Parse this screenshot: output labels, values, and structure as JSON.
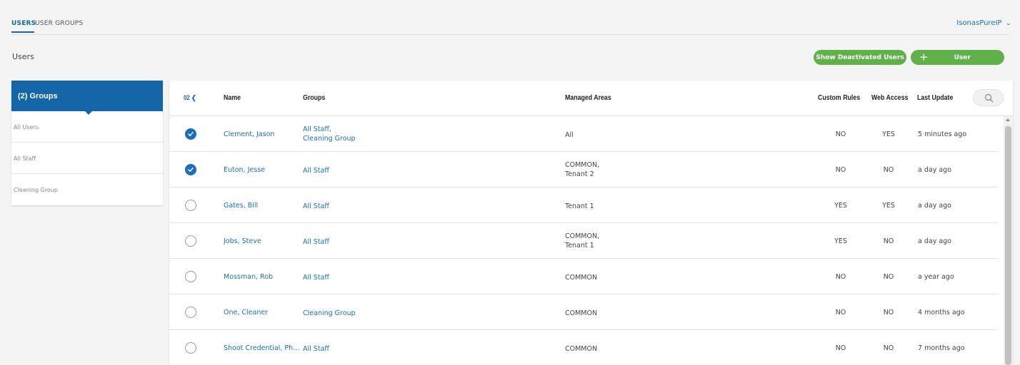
{
  "tabs": [
    {
      "label": "USERS",
      "active": true
    },
    {
      "label": "USER GROUPS",
      "active": false
    }
  ],
  "account": {
    "name": "IsonasPureIP",
    "icon": "chevron-down-icon"
  },
  "page_title": "Users",
  "actions": {
    "show_deactivated": "Show Deactivated Users",
    "add_user_icon": "+",
    "add_user": "User"
  },
  "groups_panel": {
    "header": "(2) Groups",
    "items": [
      "All Users",
      "All Staff",
      "Cleaning Group"
    ]
  },
  "table": {
    "selected_count": "02",
    "columns": {
      "name": "Name",
      "groups": "Groups",
      "areas": "Managed Areas",
      "custom_rules": "Custom Rules",
      "web_access": "Web Access",
      "last_update": "Last Update"
    },
    "rows": [
      {
        "checked": true,
        "name": "Clement, Jason",
        "groups": [
          "All Staff,",
          "Cleaning Group"
        ],
        "areas": [
          "All"
        ],
        "custom_rules": "NO",
        "web_access": "YES",
        "last_update": "5 minutes ago"
      },
      {
        "checked": true,
        "name": "Euton, Jesse",
        "groups": [
          "All Staff"
        ],
        "areas": [
          "COMMON,",
          "Tenant 2"
        ],
        "custom_rules": "NO",
        "web_access": "NO",
        "last_update": "a day ago"
      },
      {
        "checked": false,
        "name": "Gates, Bill",
        "groups": [
          "All Staff"
        ],
        "areas": [
          "Tenant 1"
        ],
        "custom_rules": "YES",
        "web_access": "YES",
        "last_update": "a day ago"
      },
      {
        "checked": false,
        "name": "Jobs, Steve",
        "groups": [
          "All Staff"
        ],
        "areas": [
          "COMMON,",
          "Tenant 1"
        ],
        "custom_rules": "YES",
        "web_access": "NO",
        "last_update": "a day ago"
      },
      {
        "checked": false,
        "name": "Mossman, Rob",
        "groups": [
          "All Staff"
        ],
        "areas": [
          "COMMON"
        ],
        "custom_rules": "NO",
        "web_access": "NO",
        "last_update": "a year ago"
      },
      {
        "checked": false,
        "name": "One, Cleaner",
        "groups": [
          "Cleaning Group"
        ],
        "areas": [
          "COMMON"
        ],
        "custom_rules": "NO",
        "web_access": "NO",
        "last_update": "4 months ago"
      },
      {
        "checked": false,
        "name": "Shoot Credential, Pho...",
        "groups": [
          "All Staff"
        ],
        "areas": [
          "COMMON"
        ],
        "custom_rules": "NO",
        "web_access": "NO",
        "last_update": "7 months ago"
      }
    ]
  },
  "colors": {
    "accent": "#1466a8",
    "link": "#1a6fb8",
    "button": "#61b14b"
  }
}
